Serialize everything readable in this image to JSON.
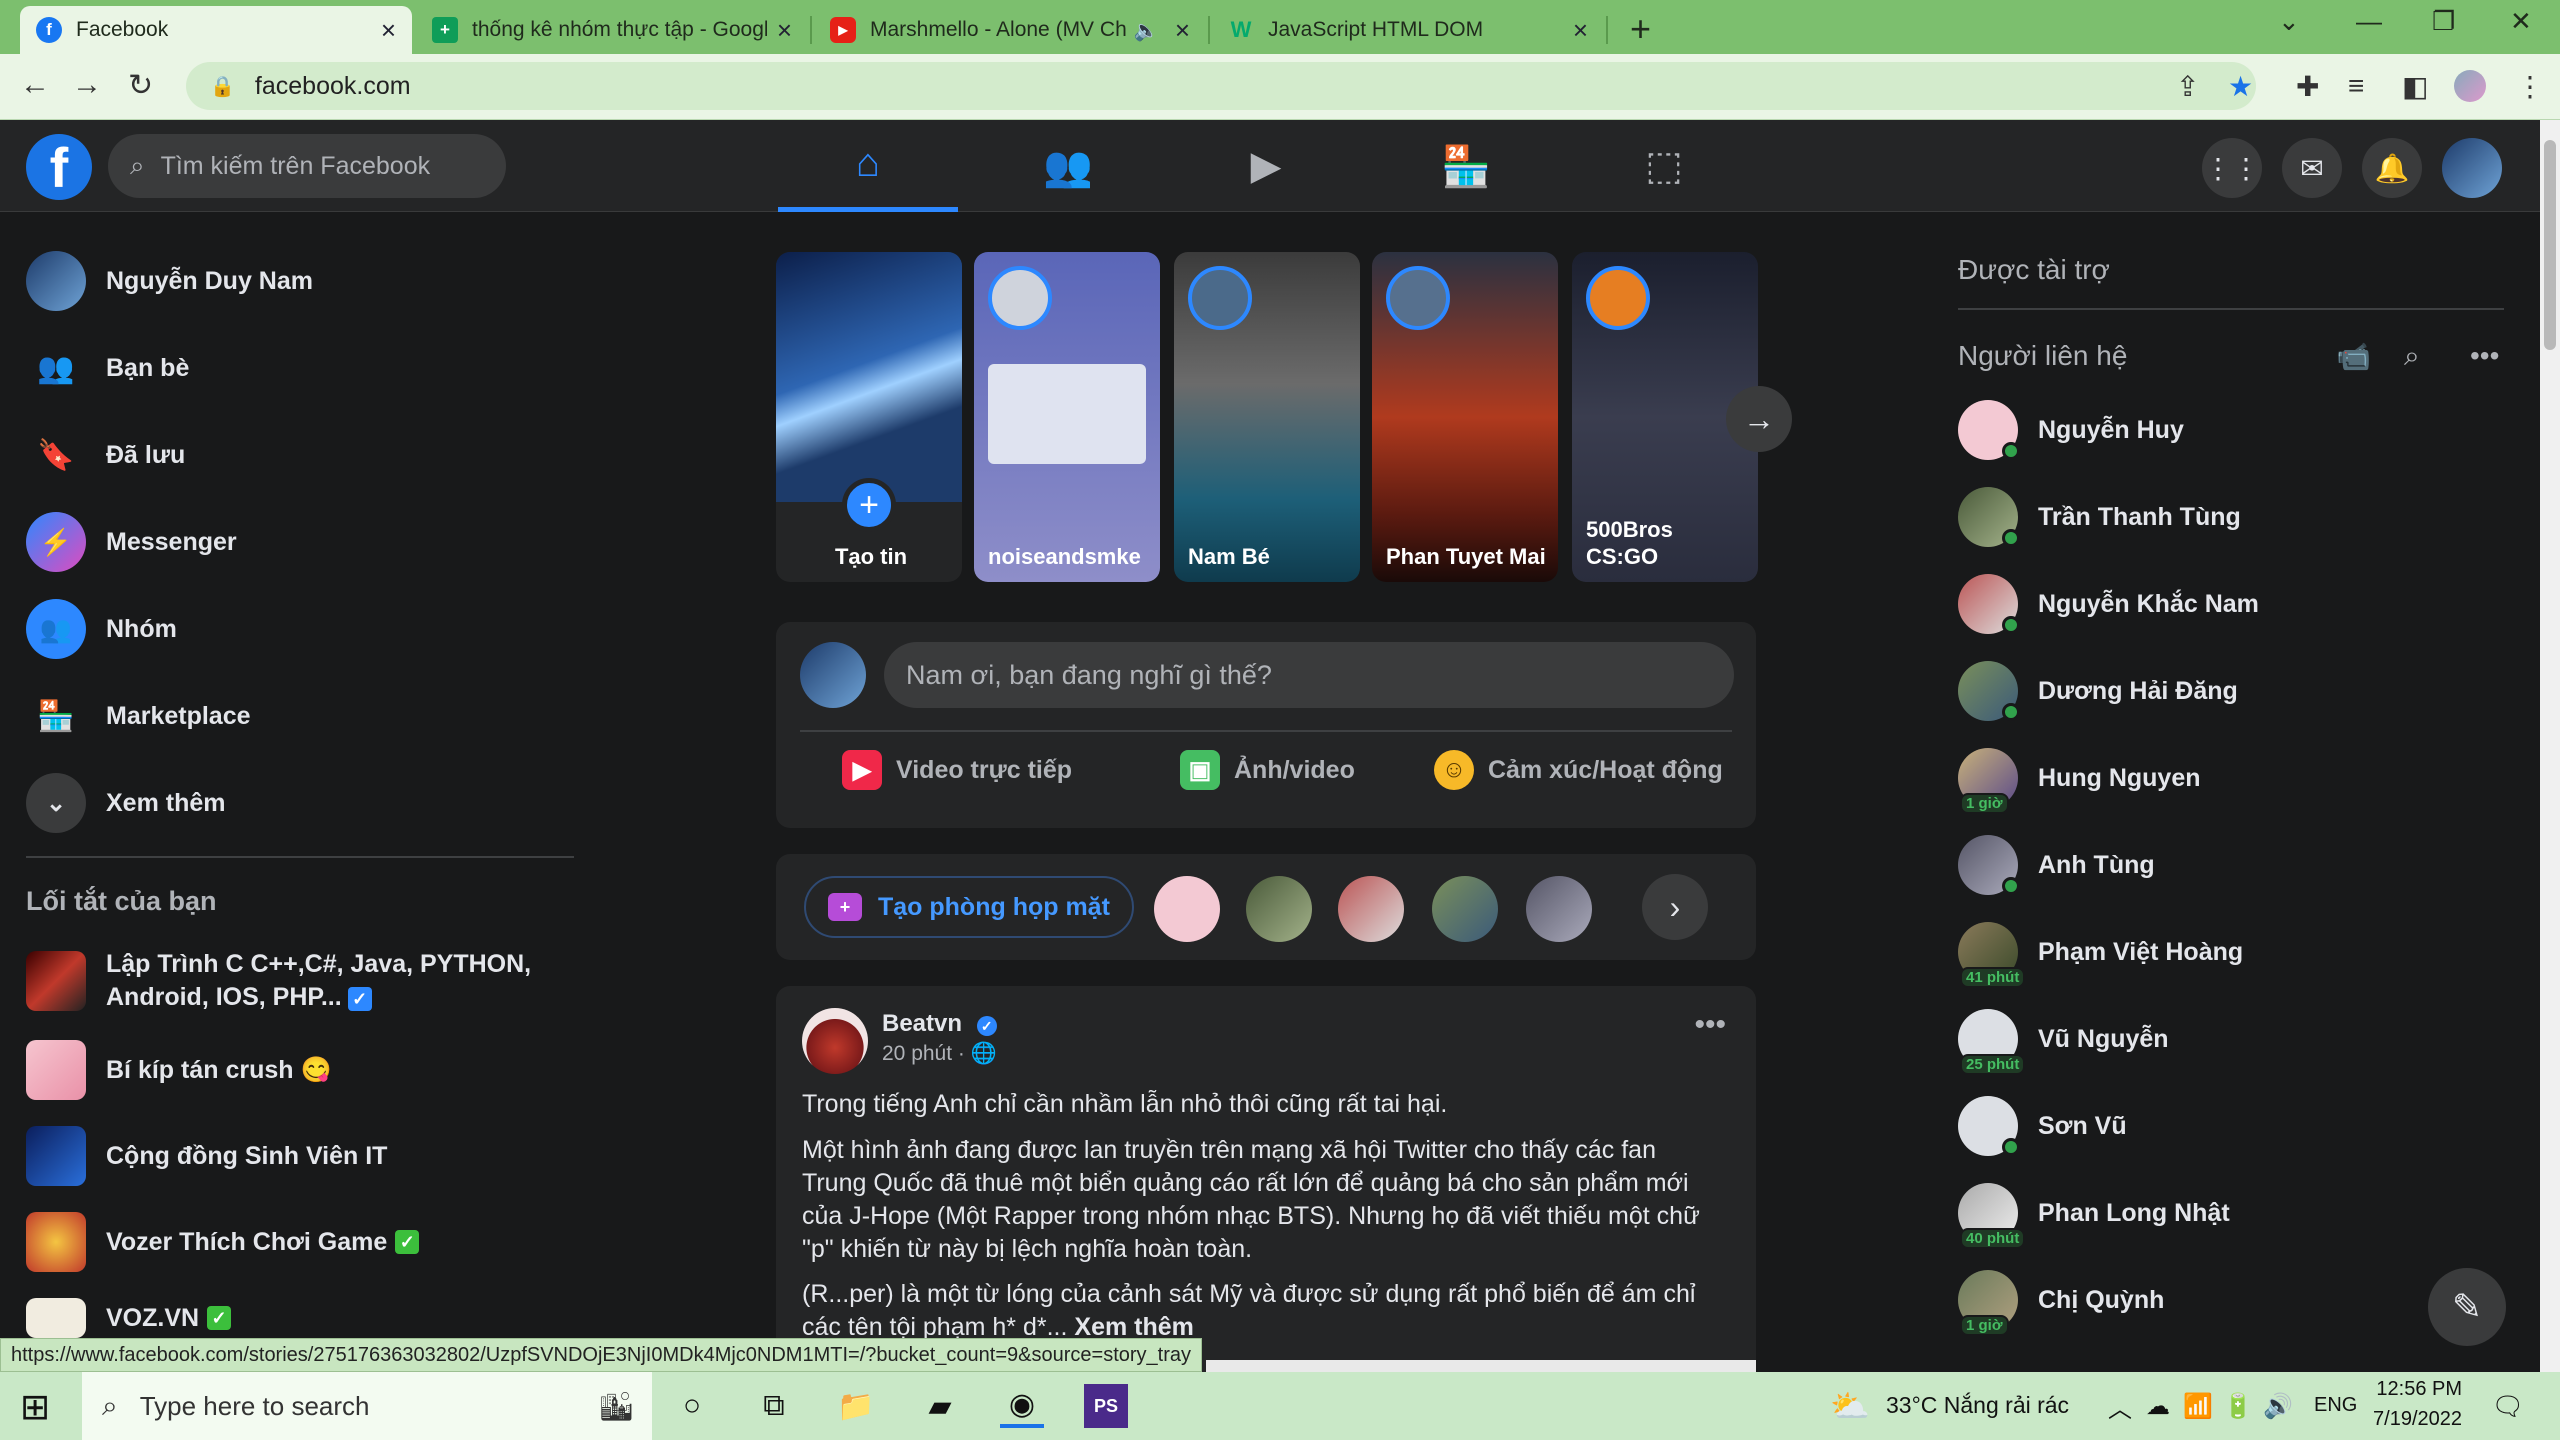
{
  "browser": {
    "tabs": [
      {
        "title": "Facebook"
      },
      {
        "title": "thống kê nhóm thực tập - Googl"
      },
      {
        "title": "Marshmello - Alone (MV Chi"
      },
      {
        "title": "JavaScript HTML DOM"
      }
    ],
    "url": "facebook.com",
    "status_url": "https://www.facebook.com/stories/275176363032802/UzpfSVNDOjE3NjI0MDk4Mjc0NDM1MTI=/?bucket_count=9&source=story_tray"
  },
  "header": {
    "search_placeholder": "Tìm kiếm trên Facebook"
  },
  "left_nav": {
    "items": [
      {
        "label": "Nguyễn Duy Nam"
      },
      {
        "label": "Bạn bè"
      },
      {
        "label": "Đã lưu"
      },
      {
        "label": "Messenger"
      },
      {
        "label": "Nhóm"
      },
      {
        "label": "Marketplace"
      },
      {
        "label": "Xem thêm"
      }
    ],
    "shortcuts_heading": "Lối tắt của bạn",
    "shortcuts": [
      {
        "label": "Lập Trình C C++,C#, Java, PYTHON, Android, IOS, PHP..."
      },
      {
        "label": "Bí kíp tán crush 😋"
      },
      {
        "label": "Cộng đồng Sinh Viên IT"
      },
      {
        "label": "Vozer Thích Chơi Game"
      },
      {
        "label": "VOZ.VN"
      }
    ]
  },
  "stories": [
    {
      "name": "Tạo tin"
    },
    {
      "name": "noiseandsmke"
    },
    {
      "name": "Nam Bé"
    },
    {
      "name": "Phan Tuyet Mai"
    },
    {
      "name": "500Bros CS:GO"
    }
  ],
  "composer": {
    "placeholder": "Nam ơi, bạn đang nghĩ gì thế?",
    "actions": [
      {
        "label": "Video trực tiếp"
      },
      {
        "label": "Ảnh/video"
      },
      {
        "label": "Cảm xúc/Hoạt động"
      }
    ]
  },
  "rooms": {
    "create_label": "Tạo phòng họp mặt"
  },
  "post": {
    "author": "Beatvn",
    "time": "20 phút ·",
    "paragraphs": [
      "Trong tiếng Anh chỉ cần nhầm lẫn nhỏ thôi cũng rất tai hại.",
      "Một hình ảnh đang được lan truyền trên mạng xã hội Twitter cho thấy các fan Trung Quốc đã thuê một biển quảng cáo rất lớn để quảng bá cho sản phẩm mới của J-Hope (Một Rapper trong nhóm nhạc BTS). Nhưng họ đã viết thiếu một chữ \"p\" khiến từ này bị lệch nghĩa hoàn toàn.",
      "(R...per) là một từ lóng của cảnh sát Mỹ và được sử dụng rất phổ biến để ám chỉ các tên tội phạm h* d*... "
    ],
    "see_more": "Xem thêm"
  },
  "right": {
    "sponsored_heading": "Được tài trợ",
    "contacts_heading": "Người liên hệ",
    "contacts": [
      {
        "name": "Nguyễn Huy",
        "ago": ""
      },
      {
        "name": "Trần Thanh Tùng",
        "ago": ""
      },
      {
        "name": "Nguyễn Khắc Nam",
        "ago": ""
      },
      {
        "name": "Dương Hải Đăng",
        "ago": ""
      },
      {
        "name": "Hung Nguyen",
        "ago": "1 giờ"
      },
      {
        "name": "Anh Tùng",
        "ago": ""
      },
      {
        "name": "Phạm Việt Hoàng",
        "ago": "41 phút"
      },
      {
        "name": "Vũ Nguyễn",
        "ago": "25 phút"
      },
      {
        "name": "Sơn Vũ",
        "ago": ""
      },
      {
        "name": "Phan Long Nhật",
        "ago": "40 phút"
      },
      {
        "name": "Chị Quỳnh",
        "ago": "1 giờ"
      }
    ]
  },
  "taskbar": {
    "search_placeholder": "Type here to search",
    "weather": "33°C  Nắng rải rác",
    "lang": "ENG",
    "time": "12:56 PM",
    "date": "7/19/2022"
  },
  "colors": {
    "fb_blue": "#2d88ff",
    "bg": "#18191a",
    "card": "#242526",
    "online": "#31a24c"
  }
}
